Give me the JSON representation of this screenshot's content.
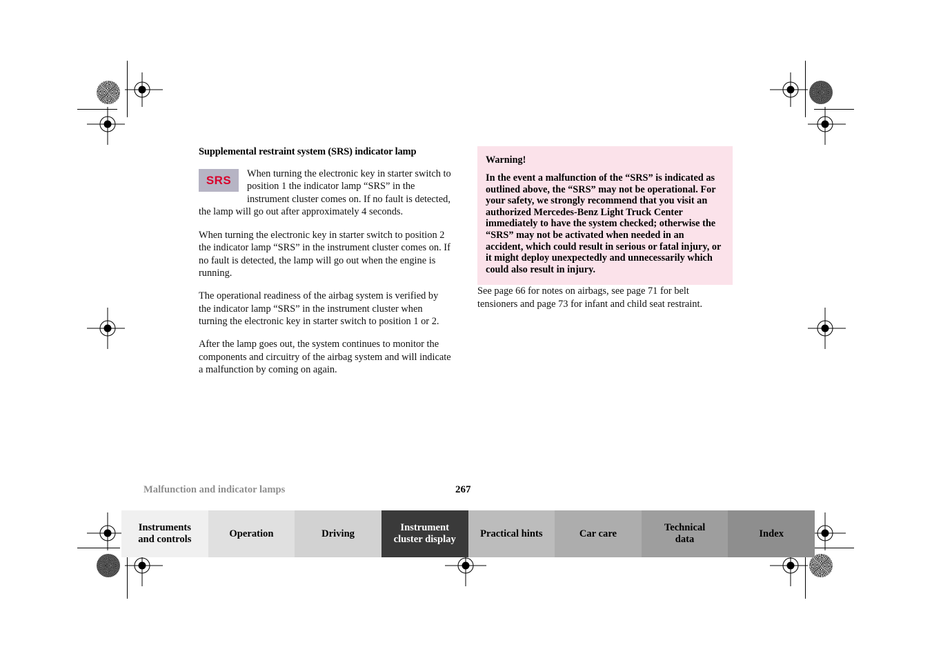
{
  "document": {
    "page_number": "267",
    "chapter_footer": "Malfunction and indicator lamps"
  },
  "left_column": {
    "section_title": "Supplemental restraint system (SRS) indicator lamp",
    "badge_label": "SRS",
    "badge_bg_color": "#b6b4c4",
    "badge_text_color": "#d9002b",
    "paragraphs": [
      "When turning the electronic key in starter switch to position 1 the indicator lamp “SRS” in the instrument cluster comes on. If no fault is detected, the lamp will go out after approximately 4 seconds.",
      "When turning the electronic key in starter switch to position 2 the indicator lamp “SRS” in the instrument cluster comes on. If no fault is detected, the lamp will go out when the engine is running.",
      "The operational readiness of the airbag system is verified by the indicator lamp “SRS” in the instrument cluster when turning the electronic key in starter switch to position 1 or 2.",
      "After the lamp goes out, the system continues to monitor the components and circuitry of the airbag system and will indicate a malfunction by coming on again."
    ]
  },
  "right_column": {
    "warning": {
      "title": "Warning!",
      "background_color": "#fbe2ea",
      "text": "In the event a malfunction of the “SRS” is indicated as outlined above, the “SRS” may not be operational. For your safety, we strongly recommend that you visit an authorized Mercedes-Benz Light Truck Center immediately to have the system checked; otherwise the “SRS” may not be activated when needed in an accident, which could result in serious or fatal injury, or it might deploy unexpectedly and unnecessarily which could also result in injury."
    },
    "cross_reference": "See page 66 for notes on airbags, see page 71 for belt tensioners and page 73 for infant and child seat restraint."
  },
  "tabbar": {
    "active_index": 3,
    "tabs": [
      {
        "line1": "Instruments",
        "line2": "and controls",
        "color": "#f0f0f0",
        "active": false
      },
      {
        "line1": "Operation",
        "line2": "",
        "color": "#e0e0e0",
        "active": false
      },
      {
        "line1": "Driving",
        "line2": "",
        "color": "#d2d2d2",
        "active": false
      },
      {
        "line1": "Instrument",
        "line2": "cluster display",
        "color": "#3a3a3a",
        "active": true
      },
      {
        "line1": "Practical hints",
        "line2": "",
        "color": "#bcbcbc",
        "active": false
      },
      {
        "line1": "Car care",
        "line2": "",
        "color": "#adadad",
        "active": false
      },
      {
        "line1": "Technical",
        "line2": "data",
        "color": "#9e9e9e",
        "active": false
      },
      {
        "line1": "Index",
        "line2": "",
        "color": "#8e8e8e",
        "active": false
      }
    ]
  }
}
